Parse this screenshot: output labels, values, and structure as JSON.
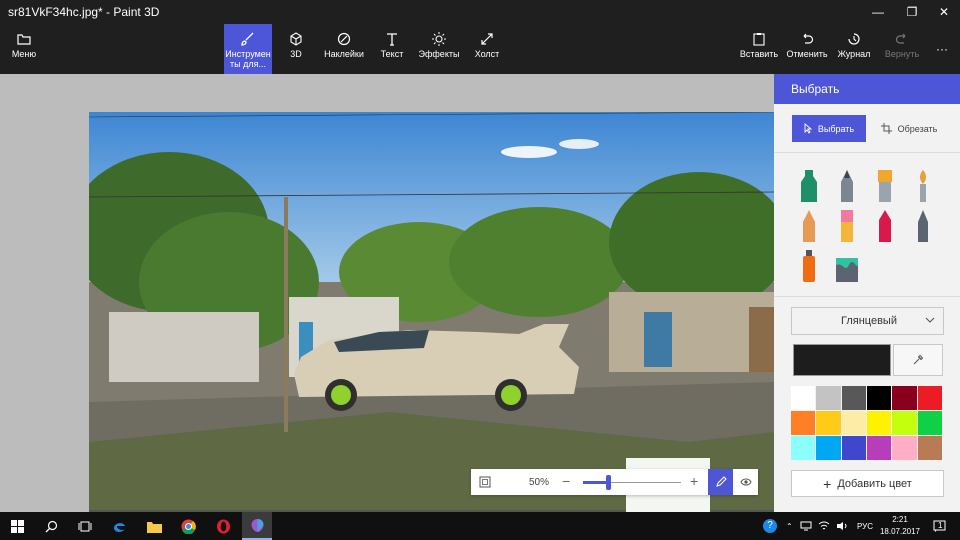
{
  "window": {
    "title": "sr81VkF34hc.jpg* - Paint 3D"
  },
  "toolbar": {
    "menu": "Меню",
    "tools": "Инструменты для...",
    "tools_line1": "Инструмен",
    "tools_line2": "ты для...",
    "three_d": "3D",
    "stickers": "Наклейки",
    "text": "Текст",
    "effects": "Эффекты",
    "canvas": "Холст",
    "paste": "Вставить",
    "undo": "Отменить",
    "history": "Журнал",
    "redo": "Вернуть",
    "more": "···"
  },
  "panel": {
    "title": "Выбрать",
    "select": "Выбрать",
    "crop": "Обрезать",
    "finish": "Глянцевый",
    "add_color": "Добавить цвет",
    "current_color": "#1d1d1d",
    "palette": [
      "#ffffff",
      "#c3c3c3",
      "#585858",
      "#000000",
      "#88001b",
      "#ec1c24",
      "#ff7f27",
      "#ffca18",
      "#fdeca6",
      "#fff200",
      "#c4ff0e",
      "#0ed145",
      "#8cfffb",
      "#00a8f3",
      "#3f48cc",
      "#b83dba",
      "#ffaec8",
      "#b97a56"
    ]
  },
  "zoom": {
    "level": "50%",
    "fraction": 0.26
  },
  "taskbar": {
    "lang": "РУС",
    "time": "2:21",
    "date": "18.07.2017",
    "notif": "1"
  }
}
